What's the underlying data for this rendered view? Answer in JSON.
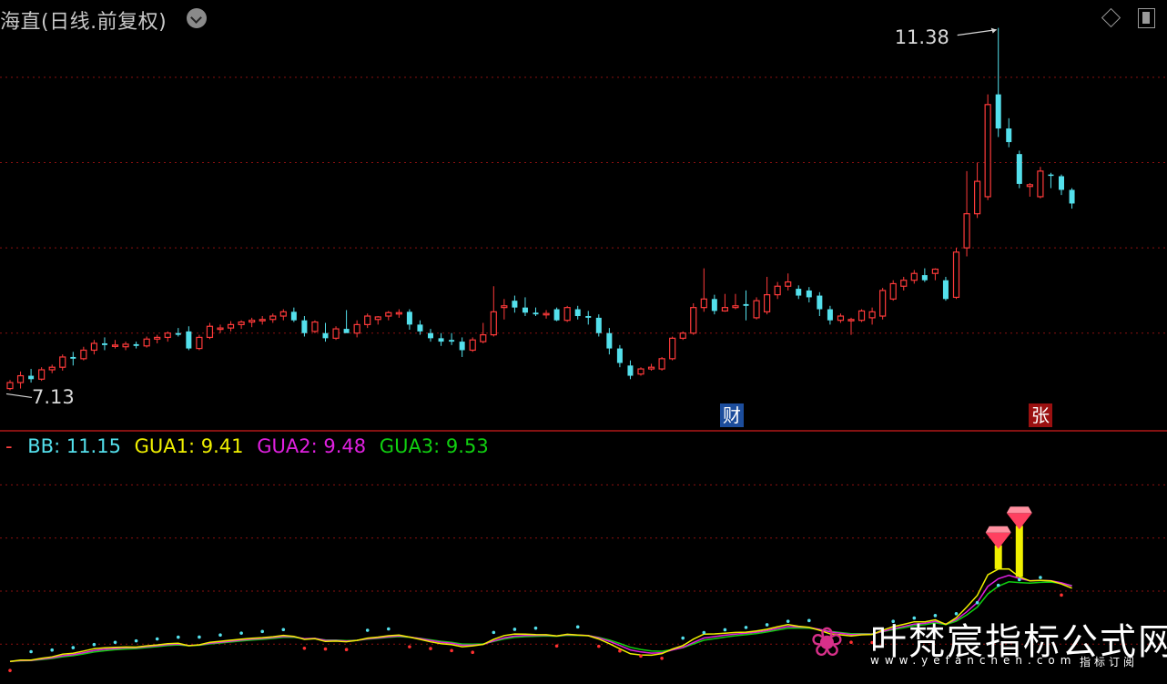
{
  "header": {
    "title": "海直(日线.前复权)"
  },
  "chart_data": [
    {
      "type": "candlestick",
      "title": "海直(日线.前复权)",
      "price_range": [
        6.9,
        11.6
      ],
      "grid_lines": [
        7.8,
        8.8,
        9.8,
        10.8
      ],
      "high_label": "11.38",
      "low_label": "7.13",
      "event_labels": [
        {
          "index": 54,
          "text": "财"
        },
        {
          "index": 96,
          "text": "张"
        }
      ],
      "candles": [
        {
          "o": 7.15,
          "h": 7.25,
          "l": 7.13,
          "c": 7.22
        },
        {
          "o": 7.22,
          "h": 7.35,
          "l": 7.15,
          "c": 7.3
        },
        {
          "o": 7.3,
          "h": 7.38,
          "l": 7.22,
          "c": 7.26
        },
        {
          "o": 7.26,
          "h": 7.4,
          "l": 7.24,
          "c": 7.37
        },
        {
          "o": 7.37,
          "h": 7.43,
          "l": 7.33,
          "c": 7.4
        },
        {
          "o": 7.4,
          "h": 7.55,
          "l": 7.36,
          "c": 7.52
        },
        {
          "o": 7.52,
          "h": 7.58,
          "l": 7.42,
          "c": 7.5
        },
        {
          "o": 7.5,
          "h": 7.64,
          "l": 7.48,
          "c": 7.6
        },
        {
          "o": 7.6,
          "h": 7.72,
          "l": 7.55,
          "c": 7.68
        },
        {
          "o": 7.68,
          "h": 7.75,
          "l": 7.6,
          "c": 7.66
        },
        {
          "o": 7.66,
          "h": 7.72,
          "l": 7.62,
          "c": 7.66
        },
        {
          "o": 7.64,
          "h": 7.7,
          "l": 7.6,
          "c": 7.67
        },
        {
          "o": 7.67,
          "h": 7.7,
          "l": 7.62,
          "c": 7.65
        },
        {
          "o": 7.65,
          "h": 7.76,
          "l": 7.63,
          "c": 7.73
        },
        {
          "o": 7.73,
          "h": 7.78,
          "l": 7.68,
          "c": 7.75
        },
        {
          "o": 7.75,
          "h": 7.82,
          "l": 7.7,
          "c": 7.8
        },
        {
          "o": 7.8,
          "h": 7.86,
          "l": 7.76,
          "c": 7.78
        },
        {
          "o": 7.82,
          "h": 7.88,
          "l": 7.6,
          "c": 7.62
        },
        {
          "o": 7.62,
          "h": 7.78,
          "l": 7.6,
          "c": 7.75
        },
        {
          "o": 7.75,
          "h": 7.92,
          "l": 7.73,
          "c": 7.88
        },
        {
          "o": 7.85,
          "h": 7.9,
          "l": 7.8,
          "c": 7.86
        },
        {
          "o": 7.86,
          "h": 7.94,
          "l": 7.82,
          "c": 7.9
        },
        {
          "o": 7.9,
          "h": 7.95,
          "l": 7.85,
          "c": 7.93
        },
        {
          "o": 7.93,
          "h": 7.98,
          "l": 7.87,
          "c": 7.95
        },
        {
          "o": 7.95,
          "h": 8.0,
          "l": 7.9,
          "c": 7.96
        },
        {
          "o": 7.96,
          "h": 8.03,
          "l": 7.92,
          "c": 8.0
        },
        {
          "o": 8.0,
          "h": 8.08,
          "l": 7.95,
          "c": 8.05
        },
        {
          "o": 8.05,
          "h": 8.1,
          "l": 7.93,
          "c": 7.95
        },
        {
          "o": 7.95,
          "h": 8.0,
          "l": 7.76,
          "c": 7.8
        },
        {
          "o": 7.82,
          "h": 7.95,
          "l": 7.8,
          "c": 7.93
        },
        {
          "o": 7.8,
          "h": 7.92,
          "l": 7.7,
          "c": 7.74
        },
        {
          "o": 7.74,
          "h": 7.88,
          "l": 7.72,
          "c": 7.85
        },
        {
          "o": 7.85,
          "h": 8.07,
          "l": 7.82,
          "c": 7.8
        },
        {
          "o": 7.8,
          "h": 7.95,
          "l": 7.75,
          "c": 7.9
        },
        {
          "o": 7.9,
          "h": 8.03,
          "l": 7.86,
          "c": 8.0
        },
        {
          "o": 7.96,
          "h": 8.0,
          "l": 7.9,
          "c": 7.99
        },
        {
          "o": 8.0,
          "h": 8.06,
          "l": 7.95,
          "c": 8.04
        },
        {
          "o": 8.04,
          "h": 8.08,
          "l": 7.98,
          "c": 8.04
        },
        {
          "o": 8.05,
          "h": 8.08,
          "l": 7.84,
          "c": 7.9
        },
        {
          "o": 7.9,
          "h": 7.95,
          "l": 7.78,
          "c": 7.82
        },
        {
          "o": 7.8,
          "h": 7.85,
          "l": 7.7,
          "c": 7.74
        },
        {
          "o": 7.74,
          "h": 7.8,
          "l": 7.65,
          "c": 7.7
        },
        {
          "o": 7.72,
          "h": 7.8,
          "l": 7.66,
          "c": 7.7
        },
        {
          "o": 7.7,
          "h": 7.75,
          "l": 7.52,
          "c": 7.6
        },
        {
          "o": 7.6,
          "h": 7.75,
          "l": 7.58,
          "c": 7.72
        },
        {
          "o": 7.7,
          "h": 7.92,
          "l": 7.68,
          "c": 7.78
        },
        {
          "o": 7.78,
          "h": 8.35,
          "l": 7.76,
          "c": 8.05
        },
        {
          "o": 8.1,
          "h": 8.2,
          "l": 7.96,
          "c": 8.12
        },
        {
          "o": 8.18,
          "h": 8.24,
          "l": 8.04,
          "c": 8.1
        },
        {
          "o": 8.1,
          "h": 8.22,
          "l": 8.0,
          "c": 8.04
        },
        {
          "o": 8.04,
          "h": 8.1,
          "l": 8.0,
          "c": 8.02
        },
        {
          "o": 8.02,
          "h": 8.07,
          "l": 7.97,
          "c": 8.03
        },
        {
          "o": 8.08,
          "h": 8.1,
          "l": 7.94,
          "c": 7.95
        },
        {
          "o": 7.95,
          "h": 8.12,
          "l": 7.93,
          "c": 8.1
        },
        {
          "o": 8.08,
          "h": 8.12,
          "l": 7.96,
          "c": 8.0
        },
        {
          "o": 8.0,
          "h": 8.06,
          "l": 7.9,
          "c": 7.98
        },
        {
          "o": 7.98,
          "h": 8.02,
          "l": 7.76,
          "c": 7.8
        },
        {
          "o": 7.8,
          "h": 7.86,
          "l": 7.55,
          "c": 7.62
        },
        {
          "o": 7.62,
          "h": 7.66,
          "l": 7.4,
          "c": 7.45
        },
        {
          "o": 7.42,
          "h": 7.48,
          "l": 7.26,
          "c": 7.3
        },
        {
          "o": 7.32,
          "h": 7.4,
          "l": 7.3,
          "c": 7.38
        },
        {
          "o": 7.38,
          "h": 7.44,
          "l": 7.36,
          "c": 7.4
        },
        {
          "o": 7.38,
          "h": 7.52,
          "l": 7.36,
          "c": 7.5
        },
        {
          "o": 7.5,
          "h": 7.76,
          "l": 7.48,
          "c": 7.74
        },
        {
          "o": 7.74,
          "h": 7.82,
          "l": 7.72,
          "c": 7.8
        },
        {
          "o": 7.8,
          "h": 8.15,
          "l": 7.78,
          "c": 8.1
        },
        {
          "o": 8.1,
          "h": 8.56,
          "l": 8.05,
          "c": 8.2
        },
        {
          "o": 8.2,
          "h": 8.25,
          "l": 8.02,
          "c": 8.06
        },
        {
          "o": 8.06,
          "h": 8.26,
          "l": 8.05,
          "c": 8.1
        },
        {
          "o": 8.1,
          "h": 8.26,
          "l": 8.08,
          "c": 8.12
        },
        {
          "o": 8.14,
          "h": 8.3,
          "l": 7.95,
          "c": 8.12
        },
        {
          "o": 7.98,
          "h": 8.22,
          "l": 7.96,
          "c": 8.18
        },
        {
          "o": 8.05,
          "h": 8.46,
          "l": 8.02,
          "c": 8.25
        },
        {
          "o": 8.25,
          "h": 8.4,
          "l": 8.2,
          "c": 8.35
        },
        {
          "o": 8.35,
          "h": 8.5,
          "l": 8.3,
          "c": 8.4
        },
        {
          "o": 8.32,
          "h": 8.36,
          "l": 8.2,
          "c": 8.24
        },
        {
          "o": 8.3,
          "h": 8.34,
          "l": 8.16,
          "c": 8.22
        },
        {
          "o": 8.24,
          "h": 8.28,
          "l": 8.0,
          "c": 8.08
        },
        {
          "o": 8.08,
          "h": 8.12,
          "l": 7.9,
          "c": 7.95
        },
        {
          "o": 7.95,
          "h": 8.03,
          "l": 7.92,
          "c": 8.0
        },
        {
          "o": 7.95,
          "h": 7.98,
          "l": 7.78,
          "c": 7.96
        },
        {
          "o": 7.95,
          "h": 8.08,
          "l": 7.93,
          "c": 8.06
        },
        {
          "o": 7.98,
          "h": 8.1,
          "l": 7.9,
          "c": 8.05
        },
        {
          "o": 8.0,
          "h": 8.33,
          "l": 7.96,
          "c": 8.3
        },
        {
          "o": 8.2,
          "h": 8.42,
          "l": 8.18,
          "c": 8.38
        },
        {
          "o": 8.35,
          "h": 8.46,
          "l": 8.3,
          "c": 8.42
        },
        {
          "o": 8.42,
          "h": 8.54,
          "l": 8.38,
          "c": 8.5
        },
        {
          "o": 8.48,
          "h": 8.56,
          "l": 8.4,
          "c": 8.42
        },
        {
          "o": 8.5,
          "h": 8.56,
          "l": 8.42,
          "c": 8.55
        },
        {
          "o": 8.42,
          "h": 8.46,
          "l": 8.18,
          "c": 8.2
        },
        {
          "o": 8.22,
          "h": 8.8,
          "l": 8.2,
          "c": 8.75
        },
        {
          "o": 8.8,
          "h": 9.7,
          "l": 8.7,
          "c": 9.2
        },
        {
          "o": 9.2,
          "h": 9.8,
          "l": 9.15,
          "c": 9.58
        },
        {
          "o": 9.4,
          "h": 10.6,
          "l": 9.36,
          "c": 10.48
        },
        {
          "o": 10.6,
          "h": 11.38,
          "l": 10.1,
          "c": 10.2
        },
        {
          "o": 10.2,
          "h": 10.32,
          "l": 9.98,
          "c": 10.04
        },
        {
          "o": 9.9,
          "h": 9.94,
          "l": 9.5,
          "c": 9.55
        },
        {
          "o": 9.52,
          "h": 9.56,
          "l": 9.4,
          "c": 9.54
        },
        {
          "o": 9.4,
          "h": 9.75,
          "l": 9.38,
          "c": 9.7
        },
        {
          "o": 9.66,
          "h": 9.68,
          "l": 9.5,
          "c": 9.65
        },
        {
          "o": 9.64,
          "h": 9.66,
          "l": 9.42,
          "c": 9.48
        },
        {
          "o": 9.48,
          "h": 9.5,
          "l": 9.26,
          "c": 9.32
        }
      ]
    },
    {
      "type": "line",
      "legend_marker": "-",
      "series": [
        {
          "name": "BB",
          "label": "BB: 11.15",
          "color": "#54e0ec",
          "style": "dots"
        },
        {
          "name": "GUA1",
          "label": "GUA1: 9.41",
          "color": "#f0f000"
        },
        {
          "name": "GUA2",
          "label": "GUA2: 9.48",
          "color": "#e020e0"
        },
        {
          "name": "GUA3",
          "label": "GUA3: 9.53",
          "color": "#10d010"
        }
      ],
      "grid_lines": [
        8.0,
        9.0,
        10.0,
        11.0
      ],
      "markers": [
        {
          "index": 94,
          "type": "gem",
          "color": "#ff4060"
        },
        {
          "index": 96,
          "type": "gem",
          "color": "#ff4060"
        }
      ]
    }
  ],
  "watermark": {
    "main": "叶梵宸指标公式网",
    "url": "www.yefanchen.com",
    "sub": "指标订阅",
    "logo_icon": "lotus-icon"
  }
}
